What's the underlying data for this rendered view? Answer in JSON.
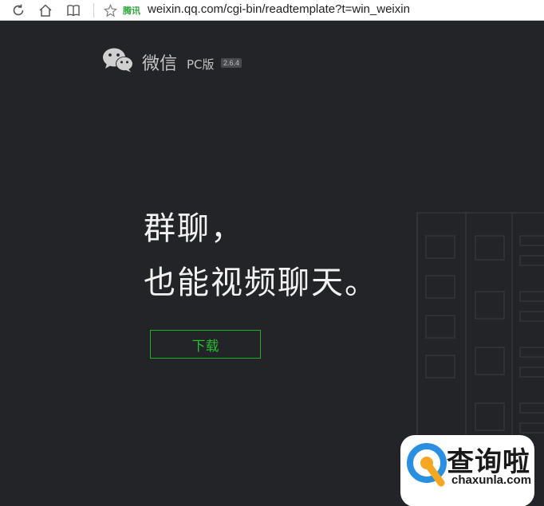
{
  "browser": {
    "site_badge": "腾讯",
    "url": "weixin.qq.com/cgi-bin/readtemplate?t=win_weixin"
  },
  "header": {
    "product_name": "微信",
    "edition": "PC版",
    "version": "2.6.4"
  },
  "hero": {
    "line1": "群聊，",
    "line2": "也能视频聊天。"
  },
  "download_button": {
    "label": "下载"
  },
  "watermark": {
    "title": "查询啦",
    "domain": "chaxunla.com"
  },
  "colors": {
    "page_bg": "#232428",
    "accent_green": "#1fae2a",
    "headline_text": "#f2f2f2"
  }
}
